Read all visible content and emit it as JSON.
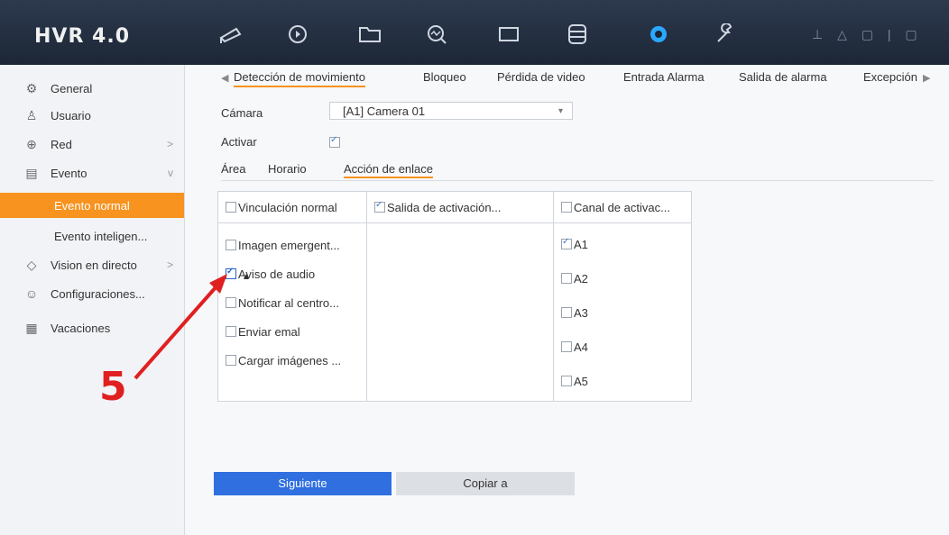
{
  "app": {
    "logo": "HVR 4.0"
  },
  "topbar": {
    "icons": [
      "camera-icon",
      "playback-icon",
      "folder-icon",
      "search-icon",
      "display-icon",
      "storage-icon",
      "settings-icon",
      "tools-icon"
    ],
    "active_icon": "settings-icon",
    "accent_color": "#2aa7ff"
  },
  "sidebar": {
    "items": [
      {
        "label": "General",
        "icon": "gear-icon"
      },
      {
        "label": "Usuario",
        "icon": "user-icon"
      },
      {
        "label": "Red",
        "icon": "globe-icon",
        "arrow": ">"
      },
      {
        "label": "Evento",
        "icon": "event-icon",
        "arrow": "v"
      },
      {
        "label": "Evento normal",
        "selected": true
      },
      {
        "label": "Evento inteligen..."
      },
      {
        "label": "Vision en directo",
        "icon": "camera-icon",
        "arrow": ">"
      },
      {
        "label": "Configuraciones...",
        "icon": "chat-icon"
      },
      {
        "label": "Vacaciones",
        "icon": "calendar-icon"
      }
    ],
    "selected_color": "#f7931e"
  },
  "tabs": {
    "items": [
      "Detección de movimiento",
      "Bloqueo",
      "Pérdida de video",
      "Entrada Alarma",
      "Salida de alarma",
      "Excepción"
    ],
    "active": "Detección de movimiento"
  },
  "form": {
    "camera_label": "Cámara",
    "camera_value": "[A1] Camera 01",
    "activate_label": "Activar"
  },
  "subtabs": {
    "items": [
      "Área",
      "Horario",
      "Acción de enlace"
    ],
    "active": "Acción de enlace"
  },
  "table": {
    "columns": [
      {
        "header": "Vinculación normal",
        "checked": false,
        "items": [
          {
            "label": "Imagen emergent...",
            "checked": false
          },
          {
            "label": "Aviso de audio",
            "checked": true
          },
          {
            "label": "Notificar al centro...",
            "checked": false
          },
          {
            "label": "Enviar emal",
            "checked": false
          },
          {
            "label": "Cargar imágenes ...",
            "checked": false
          }
        ]
      },
      {
        "header": "Salida de activación...",
        "checked": true,
        "items": []
      },
      {
        "header": "Canal de activac...",
        "checked": false,
        "items": [
          {
            "label": "A1",
            "checked": true
          },
          {
            "label": "A2",
            "checked": false
          },
          {
            "label": "A3",
            "checked": false
          },
          {
            "label": "A4",
            "checked": false
          },
          {
            "label": "A5",
            "checked": false
          }
        ]
      }
    ]
  },
  "buttons": {
    "next": "Siguiente",
    "copy": "Copiar a",
    "primary_color": "#2f6fe0"
  },
  "annotation": {
    "step": "5",
    "color": "#e02020"
  }
}
